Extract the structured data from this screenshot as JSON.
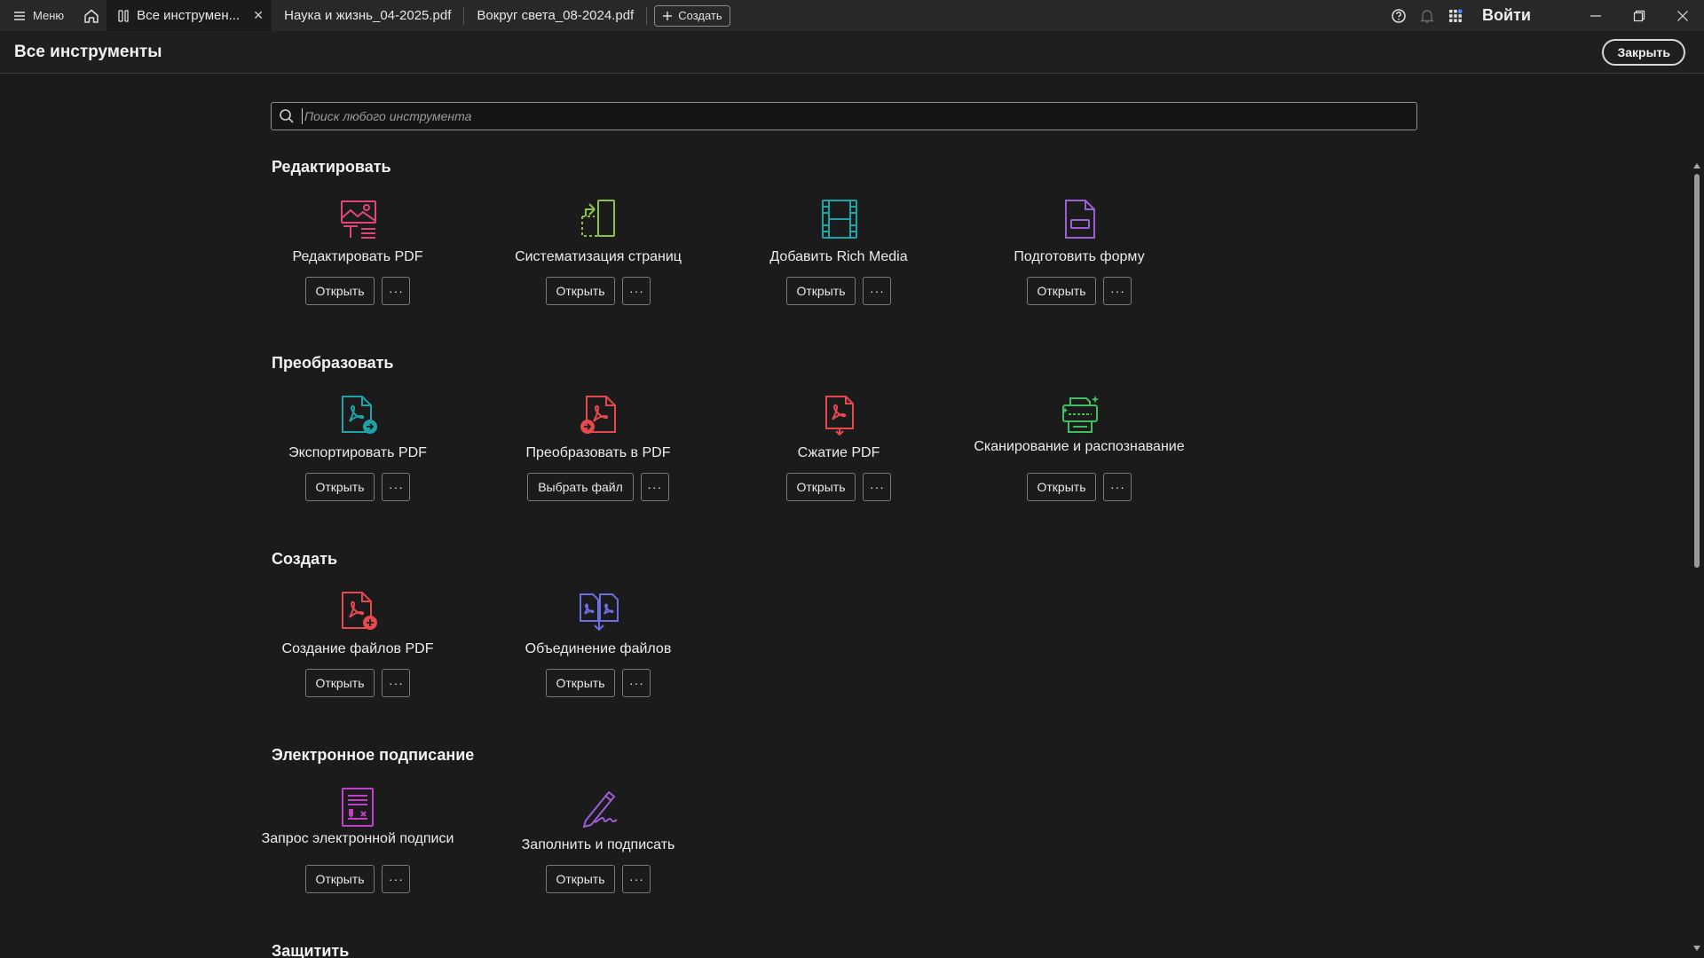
{
  "titlebar": {
    "menu_label": "Меню",
    "tabs": [
      {
        "label": "Все инструмен...",
        "active": true
      },
      {
        "label": "Наука и жизнь_04-2025.pdf",
        "active": false
      },
      {
        "label": "Вокруг света_08-2024.pdf",
        "active": false
      }
    ],
    "create_label": "Создать",
    "signin_label": "Войти"
  },
  "header": {
    "title": "Все инструменты",
    "close_label": "Закрыть"
  },
  "search": {
    "placeholder": "Поиск любого инструмента"
  },
  "sections": [
    {
      "title": "Редактировать",
      "tools": [
        {
          "name": "Редактировать PDF",
          "button": "Открыть",
          "icon": "edit-pdf-icon",
          "color": "#e0457b"
        },
        {
          "name": "Систематизация страниц",
          "button": "Открыть",
          "icon": "organize-pages-icon",
          "color": "#8bc34a"
        },
        {
          "name": "Добавить Rich Media",
          "button": "Открыть",
          "icon": "rich-media-icon",
          "color": "#1fa3a8"
        },
        {
          "name": "Подготовить форму",
          "button": "Открыть",
          "icon": "prepare-form-icon",
          "color": "#9c5fd6"
        }
      ]
    },
    {
      "title": "Преобразовать",
      "tools": [
        {
          "name": "Экспортировать PDF",
          "button": "Открыть",
          "icon": "export-pdf-icon",
          "color": "#1fa3a8"
        },
        {
          "name": "Преобразовать в PDF",
          "button": "Выбрать файл",
          "icon": "convert-to-pdf-icon",
          "color": "#e5484d"
        },
        {
          "name": "Сжатие PDF",
          "button": "Открыть",
          "icon": "compress-pdf-icon",
          "color": "#e5484d"
        },
        {
          "name": "Сканирование и распознавание",
          "button": "Открыть",
          "icon": "scan-ocr-icon",
          "color": "#3fbf5f"
        }
      ]
    },
    {
      "title": "Создать",
      "tools": [
        {
          "name": "Создание файлов PDF",
          "button": "Открыть",
          "icon": "create-pdf-icon",
          "color": "#e5484d"
        },
        {
          "name": "Объединение файлов",
          "button": "Открыть",
          "icon": "combine-files-icon",
          "color": "#6b6ee0"
        }
      ]
    },
    {
      "title": "Электронное подписание",
      "tools": [
        {
          "name": "Запрос электронной подписи",
          "button": "Открыть",
          "icon": "request-esign-icon",
          "color": "#c23fc9"
        },
        {
          "name": "Заполнить и подписать",
          "button": "Открыть",
          "icon": "fill-sign-icon",
          "color": "#9c5fd6"
        }
      ]
    },
    {
      "title": "Защитить",
      "tools": []
    }
  ]
}
